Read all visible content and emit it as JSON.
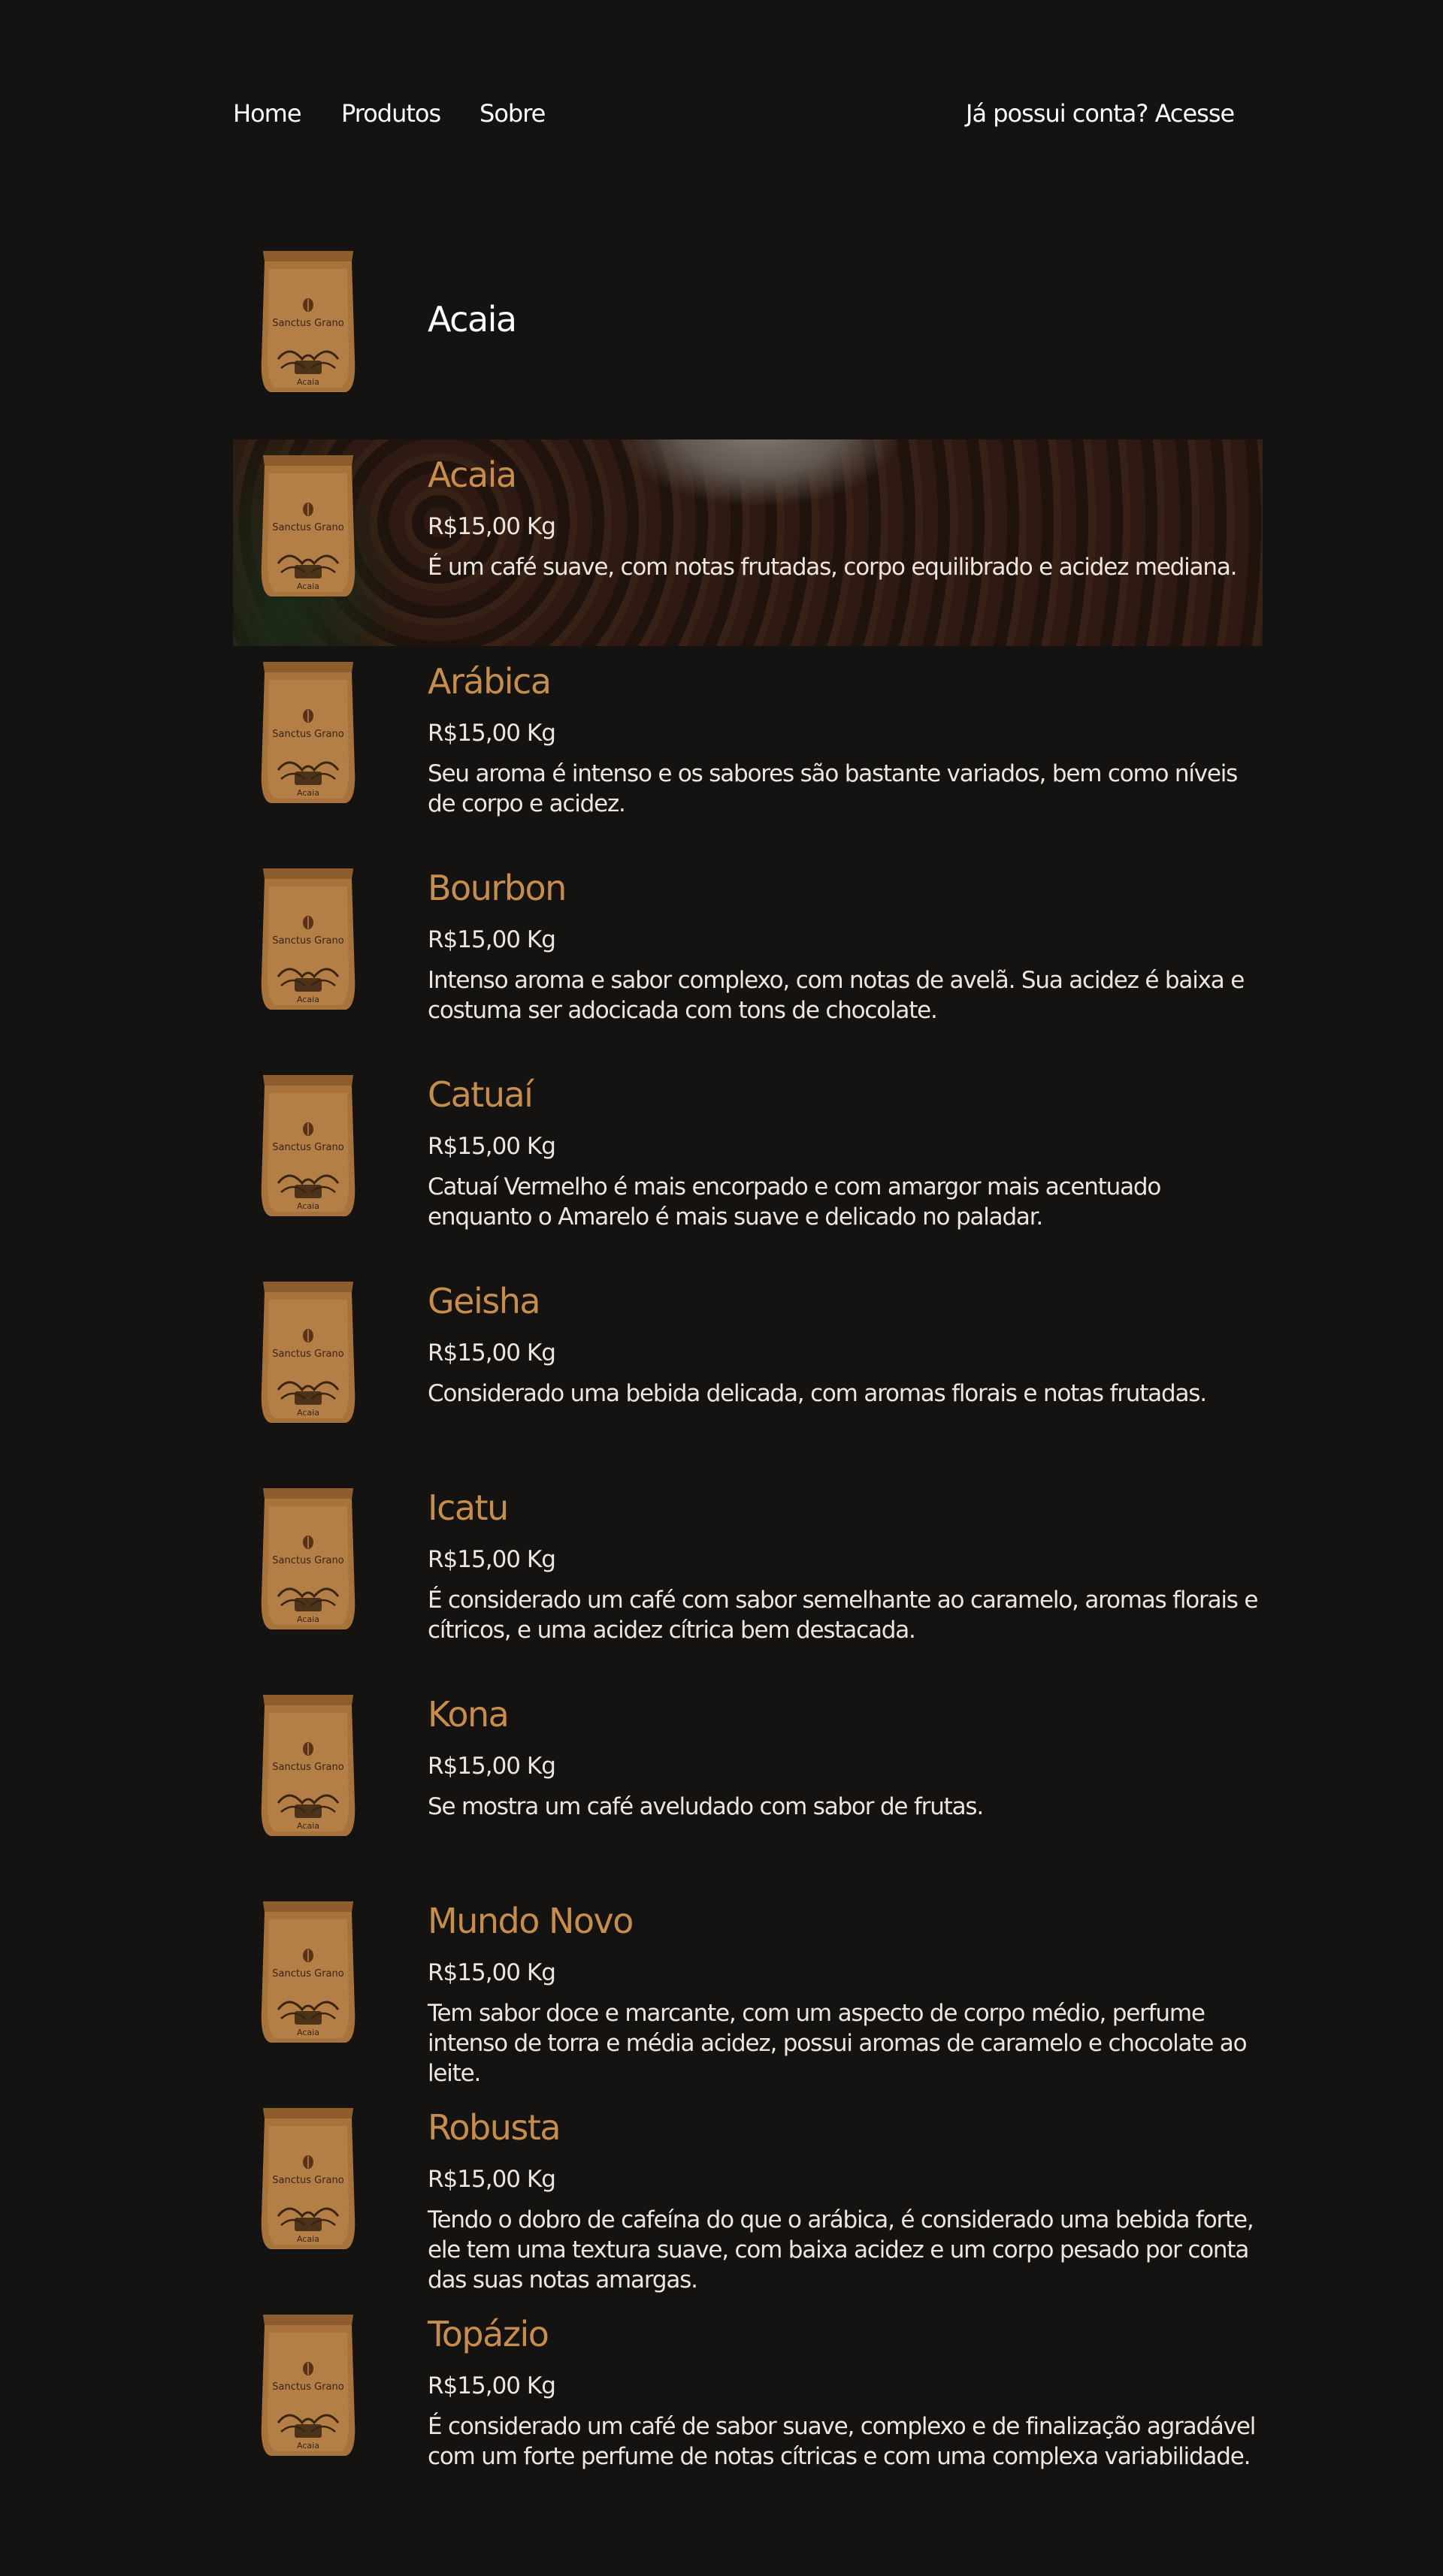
{
  "nav": {
    "home": "Home",
    "products": "Produtos",
    "about": "Sobre",
    "login": "Já possui conta? Acesse"
  },
  "hero": {
    "title": "Acaia"
  },
  "bag": {
    "brand": "Sanctus Grano",
    "variety": "Acaia"
  },
  "colors": {
    "background": "#151312",
    "accent": "#c68d4d",
    "text": "#ece6df"
  },
  "products": [
    {
      "name": "Acaia",
      "price": "R$15,00 Kg",
      "description": "É um café suave, com notas frutadas, corpo equilibrado e acidez mediana."
    },
    {
      "name": "Arábica",
      "price": "R$15,00 Kg",
      "description": "Seu aroma é intenso e os sabores são bastante variados, bem como níveis de corpo e acidez."
    },
    {
      "name": "Bourbon",
      "price": "R$15,00 Kg",
      "description": "Intenso aroma e sabor complexo, com notas de avelã. Sua acidez é baixa e costuma ser adocicada com tons de chocolate."
    },
    {
      "name": "Catuaí",
      "price": "R$15,00 Kg",
      "description": "Catuaí Vermelho é mais encorpado e com amargor mais acentuado enquanto o Amarelo é mais suave e delicado no paladar."
    },
    {
      "name": "Geisha",
      "price": "R$15,00 Kg",
      "description": "Considerado uma bebida delicada, com aromas florais e notas frutadas."
    },
    {
      "name": "Icatu",
      "price": "R$15,00 Kg",
      "description": "É considerado um café com sabor semelhante ao caramelo, aromas florais e cítricos, e uma acidez cítrica bem destacada."
    },
    {
      "name": "Kona",
      "price": "R$15,00 Kg",
      "description": "Se mostra um café aveludado com sabor de frutas."
    },
    {
      "name": "Mundo Novo",
      "price": "R$15,00 Kg",
      "description": "Tem sabor doce e marcante, com um aspecto de corpo médio, perfume intenso de torra e média acidez, possui aromas de caramelo e chocolate ao leite."
    },
    {
      "name": "Robusta",
      "price": "R$15,00 Kg",
      "description": "Tendo o dobro de cafeína do que o arábica, é considerado uma bebida forte, ele tem uma textura suave, com baixa acidez e um corpo pesado por conta das suas notas amargas."
    },
    {
      "name": "Topázio",
      "price": "R$15,00 Kg",
      "description": "É considerado um café de sabor suave, complexo e de finalização agradável com um forte perfume de notas cítricas e com uma complexa variabilidade."
    }
  ]
}
